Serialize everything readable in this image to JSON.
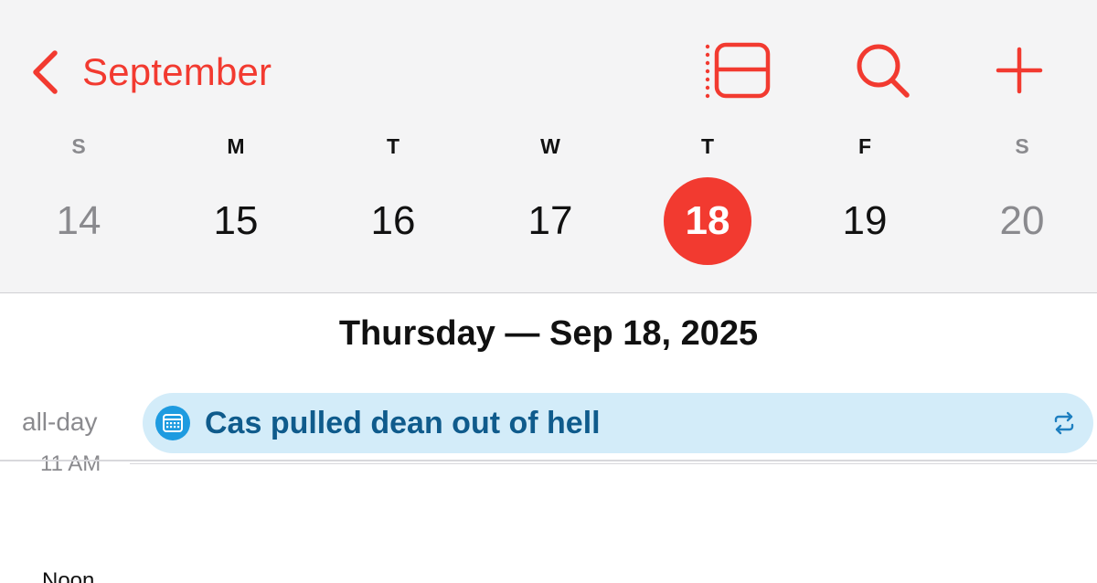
{
  "header": {
    "back_label": "September",
    "icons": {
      "back": "chevron-left-icon",
      "list_view": "list-view-icon",
      "search": "search-icon",
      "add": "plus-icon"
    },
    "accent_color": "#f23a30"
  },
  "week": {
    "days": [
      {
        "label": "S",
        "date": "14",
        "weekend": true
      },
      {
        "label": "M",
        "date": "15"
      },
      {
        "label": "T",
        "date": "16"
      },
      {
        "label": "W",
        "date": "17"
      },
      {
        "label": "T",
        "date": "18",
        "selected": true
      },
      {
        "label": "F",
        "date": "19"
      },
      {
        "label": "S",
        "date": "20",
        "weekend": true
      }
    ]
  },
  "day_view": {
    "title": "Thursday — Sep 18, 2025",
    "allday_label": "all-day",
    "event": {
      "title": "Cas pulled dean out of hell",
      "icon": "calendar-icon",
      "repeat_icon": "repeat-icon",
      "color": "#d3ecf9"
    },
    "hours": [
      "11 AM",
      "Noon"
    ]
  }
}
